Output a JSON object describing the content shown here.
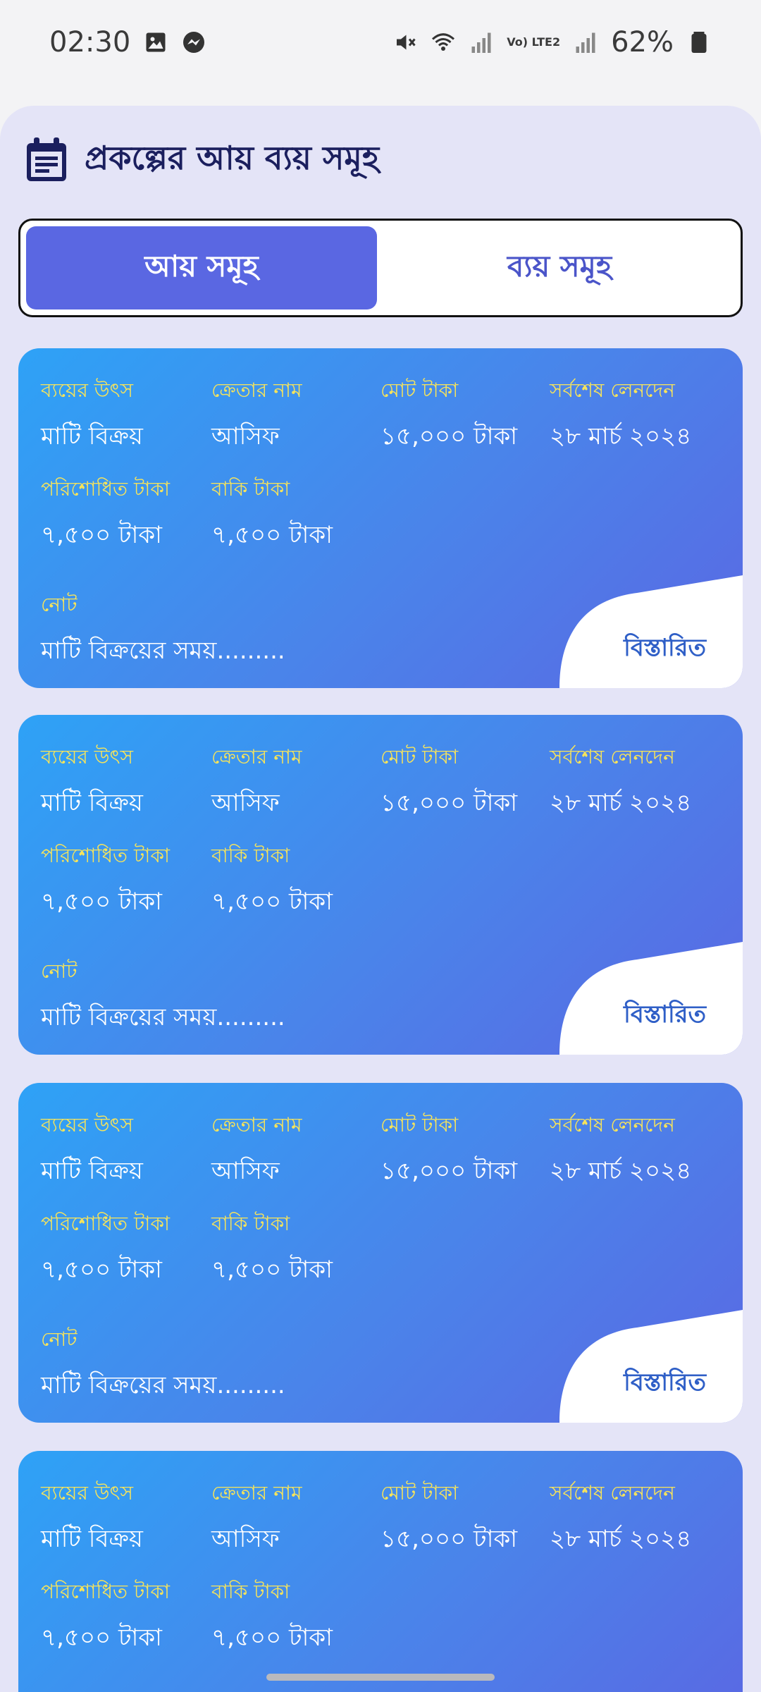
{
  "status_bar": {
    "time": "02:30",
    "lte_label": "Vo) LTE2",
    "battery": "62%",
    "icons": [
      "image-icon",
      "messenger-icon",
      "mute-icon",
      "wifi-icon",
      "signal-icon",
      "signal-icon",
      "battery-icon"
    ]
  },
  "header": {
    "title": "প্রকল্পের আয় ব্যয় সমূহ",
    "icon": "calendar-icon"
  },
  "tabs": [
    {
      "label": "আয় সমূহ",
      "active": true
    },
    {
      "label": "ব্যয় সমূহ",
      "active": false
    }
  ],
  "cards": [
    {
      "source_label": "ব্যয়ের উৎস",
      "source_value": "মাটি বিক্রয়",
      "buyer_label": "ক্রেতার নাম",
      "buyer_value": "আসিফ",
      "total_label": "মোট টাকা",
      "total_value": "১৫,০০০ টাকা",
      "last_label": "সর্বশেষ লেনদেন",
      "last_value": "২৮ মার্চ ২০২৪",
      "paid_label": "পরিশোধিত টাকা",
      "paid_value": "৭,৫০০ টাকা",
      "due_label": "বাকি টাকা",
      "due_value": "৭,৫০০ টাকা",
      "note_label": "নোট",
      "note_value": "মাটি বিক্রয়ের সময়.........",
      "details_label": "বিস্তারিত"
    },
    {
      "source_label": "ব্যয়ের উৎস",
      "source_value": "মাটি বিক্রয়",
      "buyer_label": "ক্রেতার নাম",
      "buyer_value": "আসিফ",
      "total_label": "মোট টাকা",
      "total_value": "১৫,০০০ টাকা",
      "last_label": "সর্বশেষ লেনদেন",
      "last_value": "২৮ মার্চ ২০২৪",
      "paid_label": "পরিশোধিত টাকা",
      "paid_value": "৭,৫০০ টাকা",
      "due_label": "বাকি টাকা",
      "due_value": "৭,৫০০ টাকা",
      "note_label": "নোট",
      "note_value": "মাটি বিক্রয়ের সময়.........",
      "details_label": "বিস্তারিত"
    },
    {
      "source_label": "ব্যয়ের উৎস",
      "source_value": "মাটি বিক্রয়",
      "buyer_label": "ক্রেতার নাম",
      "buyer_value": "আসিফ",
      "total_label": "মোট টাকা",
      "total_value": "১৫,০০০ টাকা",
      "last_label": "সর্বশেষ লেনদেন",
      "last_value": "২৮ মার্চ ২০২৪",
      "paid_label": "পরিশোধিত টাকা",
      "paid_value": "৭,৫০০ টাকা",
      "due_label": "বাকি টাকা",
      "due_value": "৭,৫০০ টাকা",
      "note_label": "নোট",
      "note_value": "মাটি বিক্রয়ের সময়.........",
      "details_label": "বিস্তারিত"
    },
    {
      "source_label": "ব্যয়ের উৎস",
      "source_value": "মাটি বিক্রয়",
      "buyer_label": "ক্রেতার নাম",
      "buyer_value": "আসিফ",
      "total_label": "মোট টাকা",
      "total_value": "১৫,০০০ টাকা",
      "last_label": "সর্বশেষ লেনদেন",
      "last_value": "২৮ মার্চ ২০২৪",
      "paid_label": "পরিশোধিত টাকা",
      "paid_value": "৭,৫০০ টাকা",
      "due_label": "বাকি টাকা",
      "due_value": "৭,৫০০ টাকা"
    }
  ],
  "colors": {
    "accent": "#5a67e2",
    "label_yellow": "#f7e45a",
    "title_navy": "#1b1f5e",
    "details_blue": "#2f5fc7"
  }
}
